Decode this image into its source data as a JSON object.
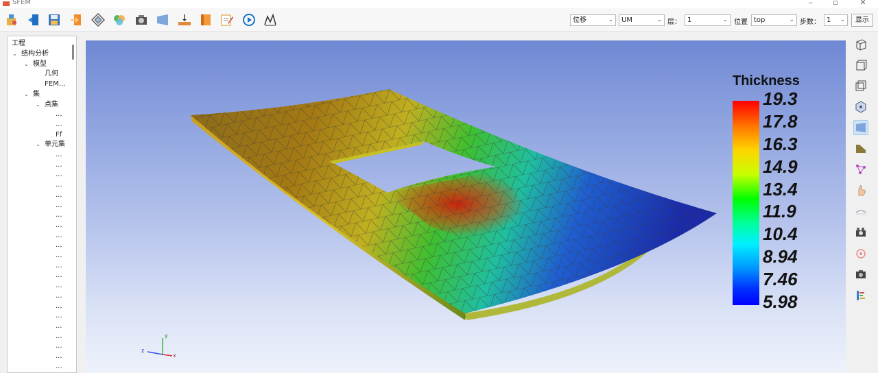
{
  "window": {
    "title": "SFEM"
  },
  "toolbar": {
    "icons": [
      "open-project-icon",
      "import-icon",
      "save-icon",
      "export-icon",
      "mesh-icon",
      "material-icon",
      "render-icon",
      "surface-icon",
      "load-icon",
      "section-icon",
      "edit-icon",
      "play-icon",
      "curve-icon"
    ],
    "result_type": {
      "value": "位移"
    },
    "component": {
      "value": "UM"
    },
    "layer_label": "层：",
    "layer": {
      "value": "1"
    },
    "position_label": "位置",
    "position": {
      "value": "top"
    },
    "step_label": "步数：",
    "step": {
      "value": "1"
    },
    "show_button": "显示"
  },
  "tree": {
    "header": "工程",
    "items": [
      {
        "label": "结构分析",
        "level": 1,
        "expanded": true
      },
      {
        "label": "模型",
        "level": 2,
        "expanded": true
      },
      {
        "label": "几何",
        "level": 3
      },
      {
        "label": "FEM...",
        "level": 3
      },
      {
        "label": "集",
        "level": 2,
        "expanded": true
      },
      {
        "label": "点集",
        "level": 3,
        "expanded": true
      },
      {
        "label": "...",
        "level": 4
      },
      {
        "label": "...",
        "level": 4
      },
      {
        "label": "Ff",
        "level": 4
      },
      {
        "label": "单元集",
        "level": 3,
        "expanded": true
      },
      {
        "label": "...",
        "level": 4
      },
      {
        "label": "...",
        "level": 4
      },
      {
        "label": "...",
        "level": 4
      },
      {
        "label": "...",
        "level": 4
      },
      {
        "label": "...",
        "level": 4
      },
      {
        "label": "...",
        "level": 4
      },
      {
        "label": "...",
        "level": 4
      },
      {
        "label": "...",
        "level": 4
      },
      {
        "label": "...",
        "level": 4
      },
      {
        "label": "...",
        "level": 4
      },
      {
        "label": "...",
        "level": 4
      },
      {
        "label": "...",
        "level": 4
      },
      {
        "label": "...",
        "level": 4
      },
      {
        "label": "...",
        "level": 4
      },
      {
        "label": "...",
        "level": 4
      },
      {
        "label": "...",
        "level": 4
      },
      {
        "label": "...",
        "level": 4
      },
      {
        "label": "...",
        "level": 4
      },
      {
        "label": "...",
        "level": 4
      },
      {
        "label": "...",
        "level": 4
      },
      {
        "label": "...",
        "level": 4
      },
      {
        "label": "...",
        "level": 4
      }
    ]
  },
  "viewport": {
    "legend": {
      "title": "Thickness",
      "values": [
        "19.3",
        "17.8",
        "16.3",
        "14.9",
        "13.4",
        "11.9",
        "10.4",
        "8.94",
        "7.46",
        "5.98"
      ]
    },
    "axes": {
      "x": "x",
      "y": "y",
      "z": "z"
    }
  },
  "right_toolbar": {
    "icons": [
      "view-iso-icon",
      "view-front-icon",
      "view-wire-icon",
      "mesh-points-icon",
      "surface-shade-icon",
      "extrude-icon",
      "nodes-icon",
      "pick-hand-icon",
      "deform-icon",
      "camera-icon",
      "reset-icon",
      "screenshot-icon",
      "chart-legend-icon"
    ],
    "active": "surface-shade-icon"
  },
  "colors": {
    "accent": "#1a73c9",
    "legend_top": "#ff0000",
    "legend_bottom": "#0000ff"
  }
}
